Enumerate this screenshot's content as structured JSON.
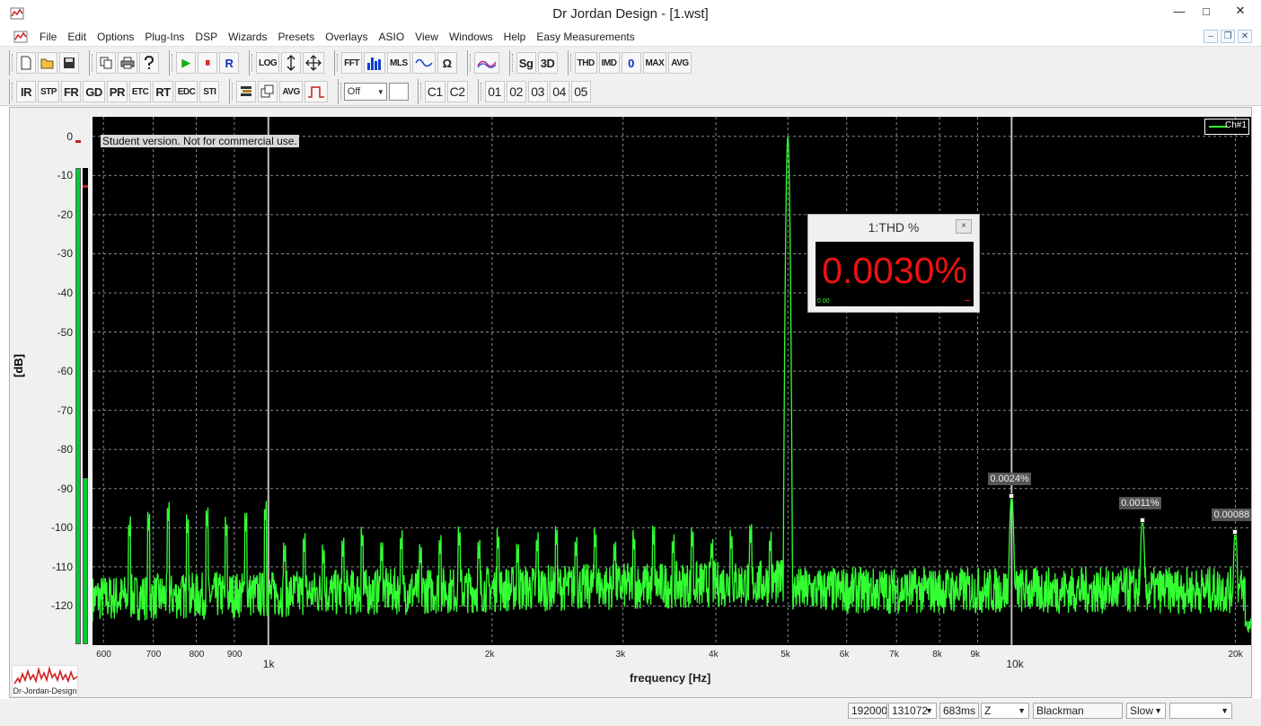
{
  "window": {
    "title": "Dr Jordan Design - [1.wst]",
    "minimize": "—",
    "maximize": "□",
    "close": "✕"
  },
  "menu": {
    "items": [
      "File",
      "Edit",
      "Options",
      "Plug-Ins",
      "DSP",
      "Wizards",
      "Presets",
      "Overlays",
      "ASIO",
      "View",
      "Windows",
      "Help",
      "Easy Measurements"
    ],
    "mdi_min": "–",
    "mdi_restore": "❐",
    "mdi_close": "✕"
  },
  "toolbar": {
    "row1_text": [
      "LOG",
      "FFT",
      "MLS",
      "Sg",
      "3D",
      "THD",
      "IMD",
      "0",
      "MAX",
      "AVG"
    ],
    "row2_text": [
      "IR",
      "STP",
      "FR",
      "GD",
      "PR",
      "ETC",
      "RT",
      "EDC",
      "STI",
      "AVG"
    ],
    "off_select": "Off",
    "channels": [
      "C1",
      "C2"
    ],
    "presets": [
      "01",
      "02",
      "03",
      "04",
      "05"
    ],
    "play_glyph": "▶",
    "pause_glyph": "⏸",
    "record_label": "R",
    "omega": "Ω"
  },
  "plot": {
    "student_notice": "Student version. Not for commercial use.",
    "legend_label": "Ch#1",
    "colors": {
      "trace": "#33ff33",
      "background": "#000000",
      "thd_value": "#ee1111"
    }
  },
  "thd_window": {
    "header": "1:THD %",
    "close": "×",
    "value": "0.0030%",
    "mini_left": "0.00"
  },
  "markers": [
    {
      "label": "0.0024%",
      "freq": 10000,
      "level": -92
    },
    {
      "label": "0.0011%",
      "freq": 15000,
      "level": -98
    },
    {
      "label": "0.00088",
      "freq": 20000,
      "level": -101
    }
  ],
  "axes": {
    "ylabel": "[dB]",
    "xlabel": "frequency [Hz]",
    "yticks": [
      "0",
      "-10",
      "-20",
      "-30",
      "-40",
      "-50",
      "-60",
      "-70",
      "-80",
      "-90",
      "-100",
      "-110",
      "-120"
    ],
    "xticks_minor": [
      "600",
      "700",
      "800",
      "900",
      "2k",
      "3k",
      "4k",
      "5k",
      "6k",
      "7k",
      "8k",
      "9k",
      "20k"
    ],
    "xticks_major": [
      "1k",
      "10k"
    ]
  },
  "chart_data": {
    "type": "line",
    "xscale": "log",
    "xlim": [
      580,
      21000
    ],
    "ylim": [
      -130,
      5
    ],
    "xlabel": "frequency [Hz]",
    "ylabel": "[dB]",
    "legend": "top-right",
    "grid": true,
    "series": [
      {
        "name": "Ch#1",
        "x": [
          580,
          620,
          650,
          700,
          750,
          800,
          860,
          900,
          950,
          1000,
          1200,
          1500,
          2000,
          2500,
          3000,
          3500,
          4000,
          4500,
          4900,
          5000,
          5100,
          5500,
          6000,
          7000,
          8000,
          9000,
          10000,
          12000,
          15000,
          18000,
          20000,
          21000
        ],
        "y": [
          -122,
          -118,
          -102,
          -119,
          -103,
          -117,
          -101,
          -118,
          -100,
          -116,
          -118,
          -117,
          -114,
          -113,
          -112,
          -114,
          -113,
          -111,
          -110,
          0,
          -110,
          -116,
          -115,
          -115,
          -114,
          -114,
          -92,
          -116,
          -98,
          -117,
          -101,
          -125
        ]
      }
    ]
  },
  "logo": {
    "text": "Dr-Jordan-Design"
  },
  "status": {
    "sample_rate": "192000",
    "fft_size": "131072",
    "duration": "683ms",
    "weighting": "Z",
    "window_fn": "Blackman",
    "speed": "Slow",
    "extra": ""
  }
}
